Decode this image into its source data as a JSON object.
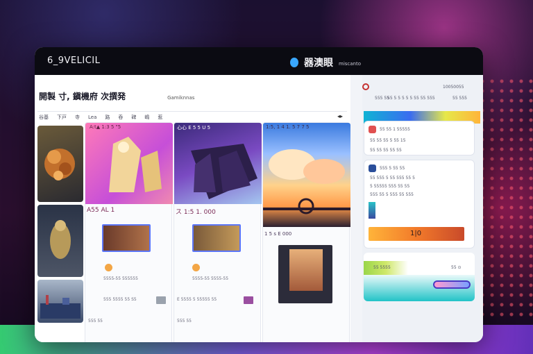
{
  "window": {
    "left_title": "6_9VELICIL",
    "brand_name": "器澳眼",
    "brand_tag": "miscanto"
  },
  "main": {
    "page_title": "開製 寸, 鎭機府 次撰発",
    "page_tag": "Gamiknnas",
    "filter_chips": [
      "谷基",
      "下戸",
      "寺",
      "Lea",
      "路",
      "呑",
      "碑",
      "嶋",
      "惹"
    ],
    "filter_toggle": "◂▸",
    "cards": [
      {
        "caption": "A:t▲ 1:3 5 \"5",
        "img_label": "golden figure"
      },
      {
        "caption": "心心 E 5 5 U 5",
        "img_label": "dark castle"
      },
      {
        "caption": "1:5, 1 4 1. 5 7 7 5",
        "img_label": "sunset sky"
      }
    ],
    "side_thumbs": [
      {
        "caption": "dancer"
      },
      {
        "caption": "figure"
      },
      {
        "caption": "city"
      }
    ],
    "prices": [
      "A55 AL 1",
      "ス 1:5 1. 000",
      "1 5 s E 000"
    ],
    "card_meta": [
      "5555-55 555555",
      "5555-55 5555-55",
      "555-55 1 555",
      "5555 55555 55"
    ],
    "row_meta": [
      "555 5555 55 S5",
      "E 5555 5 55555 55",
      "555 55",
      "555 55"
    ]
  },
  "sidebar": {
    "top_label_1": "555 55",
    "top_label_2": "10050055",
    "top_label_3": "55 5 5 5 5 5 55 55 555",
    "top_label_4": "55 555",
    "lines": [
      "55 55 1 55555",
      "55 55 55 5 55 15",
      "55 55 55 55 55",
      "555 5 55 55",
      "55 555 5 55 555 55 5",
      "5 55555 555 55 55",
      "555 55 5 555 55 555",
      "55555 5555 555 5"
    ],
    "badge": "1|0",
    "bottom_label": "55 ⊙",
    "bottom_tag": "55 5555"
  },
  "colors": {
    "accent_blue": "#3aa7ff",
    "magenta": "#d14cff",
    "teal": "#22c3c7"
  }
}
